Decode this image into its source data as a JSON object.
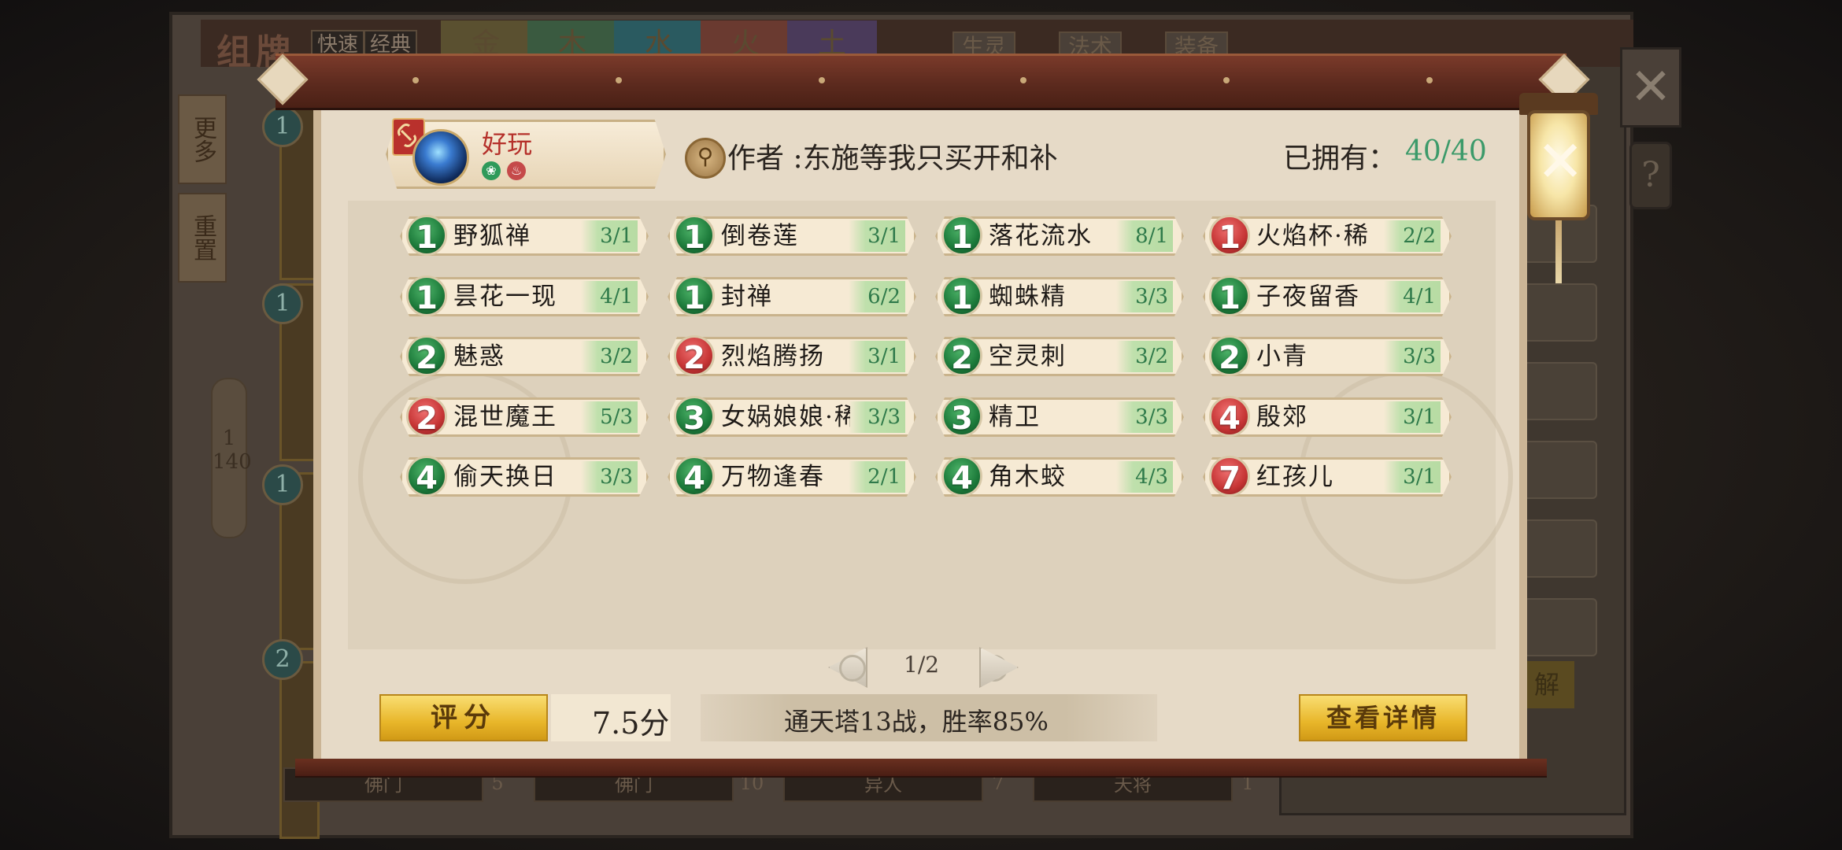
{
  "background": {
    "title": "组牌",
    "toggle_fast": "快速",
    "toggle_classic": "经典",
    "element_tabs": [
      "金",
      "木",
      "水",
      "火",
      "土"
    ],
    "filter_chips": [
      "生灵",
      "法术",
      "装备"
    ],
    "side_buttons": [
      "更多",
      "重置"
    ],
    "page_current": "1",
    "page_total": "140",
    "bottom_tabs": [
      "佛门",
      "佛门",
      "异人",
      "天将"
    ],
    "bottom_counts": [
      "5",
      "10",
      "7",
      "1"
    ],
    "side_yellow": [
      "解"
    ]
  },
  "deck": {
    "name": "好玩",
    "author_label": "作者",
    "author_name": ":东施等我只买开和补",
    "owned_label": "已拥有：",
    "owned_count": "40/40",
    "element_icons": [
      "wood-icon",
      "fire-icon"
    ]
  },
  "cards": [
    {
      "cost": "1",
      "color": "green",
      "name": "野狐禅",
      "count": "3/1"
    },
    {
      "cost": "1",
      "color": "green",
      "name": "倒卷莲",
      "count": "3/1"
    },
    {
      "cost": "1",
      "color": "green",
      "name": "落花流水",
      "count": "8/1"
    },
    {
      "cost": "1",
      "color": "red",
      "name": "火焰杯·稀",
      "count": "2/2"
    },
    {
      "cost": "1",
      "color": "green",
      "name": "昙花一现",
      "count": "4/1"
    },
    {
      "cost": "1",
      "color": "green",
      "name": "封禅",
      "count": "6/2"
    },
    {
      "cost": "1",
      "color": "green",
      "name": "蜘蛛精",
      "count": "3/3"
    },
    {
      "cost": "1",
      "color": "green",
      "name": "子夜留香",
      "count": "4/1"
    },
    {
      "cost": "2",
      "color": "green",
      "name": "魅惑",
      "count": "3/2"
    },
    {
      "cost": "2",
      "color": "red",
      "name": "烈焰腾扬",
      "count": "3/1"
    },
    {
      "cost": "2",
      "color": "green",
      "name": "空灵刺",
      "count": "3/2"
    },
    {
      "cost": "2",
      "color": "green",
      "name": "小青",
      "count": "3/3"
    },
    {
      "cost": "2",
      "color": "red",
      "name": "混世魔王",
      "count": "5/3"
    },
    {
      "cost": "3",
      "color": "green",
      "name": "女娲娘娘·稀",
      "count": "3/3"
    },
    {
      "cost": "3",
      "color": "green",
      "name": "精卫",
      "count": "3/3"
    },
    {
      "cost": "4",
      "color": "red",
      "name": "殷郊",
      "count": "3/1"
    },
    {
      "cost": "4",
      "color": "green",
      "name": "偷天换日",
      "count": "3/3"
    },
    {
      "cost": "4",
      "color": "green",
      "name": "万物逢春",
      "count": "2/1"
    },
    {
      "cost": "4",
      "color": "green",
      "name": "角木蛟",
      "count": "4/3"
    },
    {
      "cost": "7",
      "color": "red",
      "name": "红孩儿",
      "count": "3/1"
    }
  ],
  "pagination": {
    "text": "1/2"
  },
  "footer": {
    "rate_label": "评分",
    "score": "7.5分",
    "record": "通天塔13战，胜率85%",
    "detail_label": "查看详情"
  },
  "colors": {
    "cost_green": "#1c7a3a",
    "cost_red": "#c53434",
    "owned_count": "#3c9a6a",
    "deck_name": "#b5302a",
    "gold_button": "#e8b62a"
  }
}
